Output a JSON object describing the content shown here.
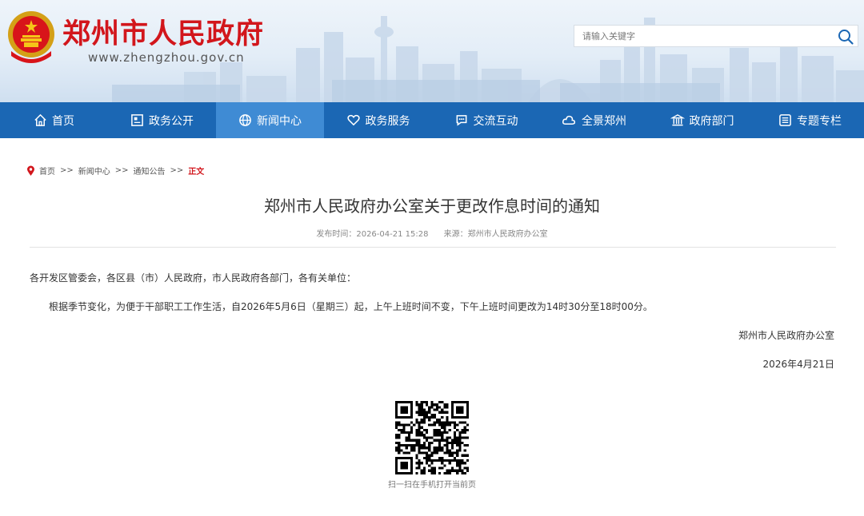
{
  "header": {
    "site_title": "郑州市人民政府",
    "site_domain": "www.zhengzhou.gov.cn",
    "search_placeholder": "请输入关键字",
    "accent_color": "#d2161c"
  },
  "nav": {
    "items": [
      {
        "label": "首页",
        "icon": "home-icon"
      },
      {
        "label": "政务公开",
        "icon": "document-icon"
      },
      {
        "label": "新闻中心",
        "icon": "globe-icon",
        "active": true
      },
      {
        "label": "政务服务",
        "icon": "heart-icon"
      },
      {
        "label": "交流互动",
        "icon": "chat-icon"
      },
      {
        "label": "全景郑州",
        "icon": "cloud-icon"
      },
      {
        "label": "政府部门",
        "icon": "building-icon"
      },
      {
        "label": "专题专栏",
        "icon": "list-icon"
      }
    ],
    "bar_color": "#1b67b4",
    "active_color": "#3f8bd4"
  },
  "breadcrumb": {
    "items": [
      "首页",
      "新闻中心",
      "通知公告"
    ],
    "separator": ">>",
    "current": "正文"
  },
  "article": {
    "title": "郑州市人民政府办公室关于更改作息时间的通知",
    "publish_time": "发布时间：2026-04-21 15:28",
    "source": "来源：郑州市人民政府办公室",
    "salutation": "各开发区管委会，各区县（市）人民政府，市人民政府各部门，各有关单位：",
    "body": "根据季节变化，为便于干部职工工作生活，自2026年5月6日（星期三）起，上午上班时间不变，下午上班时间更改为14时30分至18时00分。",
    "signature": "郑州市人民政府办公室",
    "date": "2026年4月21日"
  },
  "qr": {
    "caption": "扫一扫在手机打开当前页"
  }
}
